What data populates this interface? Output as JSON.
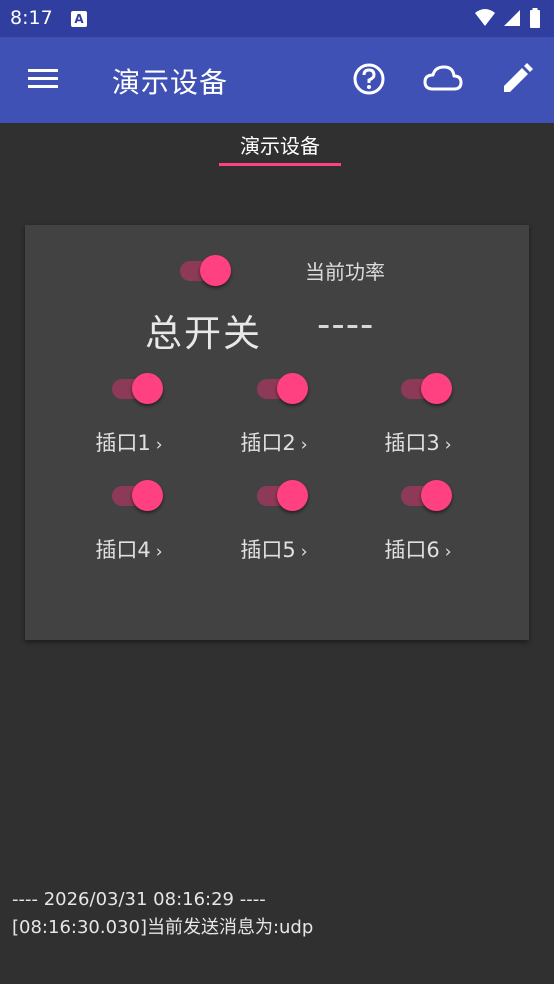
{
  "status_bar": {
    "time": "8:17",
    "notification_icon": "A"
  },
  "app_bar": {
    "title": "演示设备",
    "icons": [
      "menu-icon",
      "help-icon",
      "cloud-icon",
      "edit-icon"
    ],
    "color": "#3f51b5"
  },
  "tabs": [
    {
      "label": "演示设备",
      "selected": true
    }
  ],
  "card": {
    "master_switch": {
      "label": "总开关",
      "on": true
    },
    "power": {
      "label": "当前功率",
      "value": "----"
    },
    "outlets": [
      {
        "label": "插口1",
        "on": true
      },
      {
        "label": "插口2",
        "on": true
      },
      {
        "label": "插口3",
        "on": true
      },
      {
        "label": "插口4",
        "on": true
      },
      {
        "label": "插口5",
        "on": true
      },
      {
        "label": "插口6",
        "on": true
      }
    ]
  },
  "log": {
    "lines": [
      "---- 2026/03/31 08:16:29 ----",
      "[08:16:30.030]当前发送消息为:udp"
    ]
  },
  "colors": {
    "accent": "#ff4081",
    "primary": "#3f51b5",
    "primary_dark": "#303f9f",
    "background": "#303030",
    "card": "#424242"
  }
}
